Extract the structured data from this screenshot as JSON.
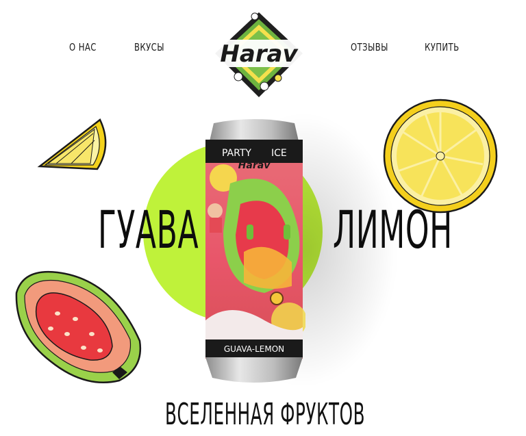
{
  "nav": {
    "about": "О НАС",
    "flavors": "ВКУСЫ",
    "reviews": "ОТЗЫВЫ",
    "buy": "КУПИТЬ"
  },
  "logo": {
    "text": "Harav"
  },
  "hero": {
    "left_word": "ГУАВА",
    "right_word": "ЛИМОН",
    "tagline": "ВСЕЛЕННАЯ ФРУКТОВ"
  },
  "can": {
    "top_left": "PARTY",
    "top_right": "ICE",
    "brand": "Harav",
    "flavor": "GUAVA-LEMON"
  },
  "colors": {
    "accent_green": "#bff23a",
    "lemon_yellow": "#f7e23a",
    "guava_red": "#e8393f",
    "guava_skin": "#9ad14a",
    "can_pink": "#e9737a"
  },
  "icons": {
    "logo": "harav-logo-icon",
    "lemon_slice": "lemon-slice-illustration",
    "lemon_half": "lemon-half-illustration",
    "guava": "guava-half-illustration",
    "can": "beer-can-illustration"
  }
}
